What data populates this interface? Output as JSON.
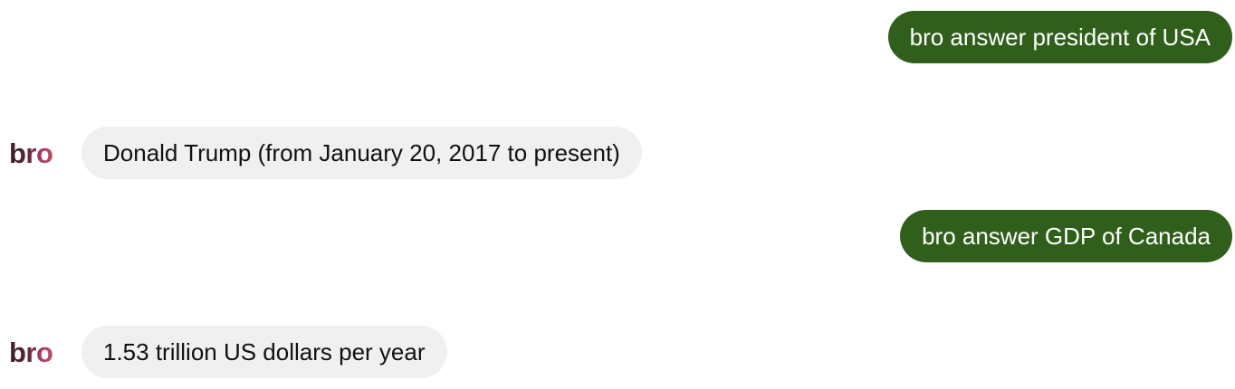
{
  "conversation": {
    "messages": [
      {
        "role": "user",
        "text": "bro answer president of USA"
      },
      {
        "role": "bot",
        "avatar_text": "bro",
        "text": "Donald Trump (from January 20, 2017 to present)"
      },
      {
        "role": "user",
        "text": "bro answer GDP of Canada"
      },
      {
        "role": "bot",
        "avatar_text": "bro",
        "text": "1.53 trillion US dollars per year"
      }
    ]
  },
  "colors": {
    "user_bubble": "#2f5f1b",
    "bot_bubble": "#f0f0f0",
    "avatar_gradient_start": "#3a1e2a",
    "avatar_gradient_end": "#c04d6b"
  }
}
